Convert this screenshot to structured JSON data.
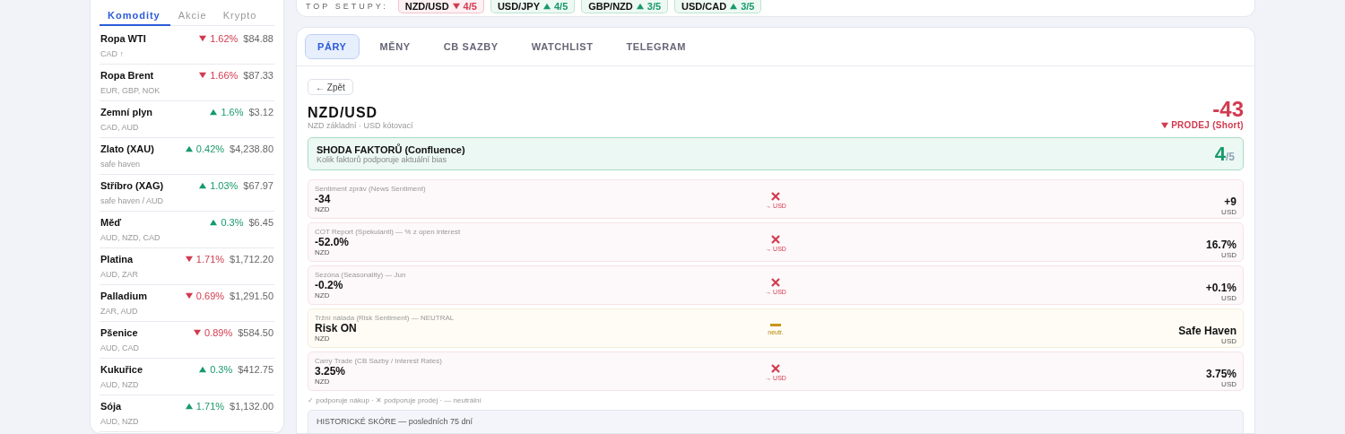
{
  "top_setups": {
    "label": "TOP SETUPY:",
    "items": [
      {
        "pair": "NZD/USD",
        "falling": true,
        "score": "4/5"
      },
      {
        "pair": "USD/JPY",
        "falling": false,
        "score": "4/5"
      },
      {
        "pair": "GBP/NZD",
        "falling": false,
        "score": "3/5"
      },
      {
        "pair": "USD/CAD",
        "falling": false,
        "score": "3/5"
      }
    ]
  },
  "sidebar": {
    "tabs": [
      {
        "label": "Komodity",
        "selected": true
      },
      {
        "label": "Akcie",
        "selected": false
      },
      {
        "label": "Krypto",
        "selected": false
      }
    ],
    "items": [
      {
        "name": "Ropa WTI",
        "falling": true,
        "change": "1.62%",
        "price": "$84.88",
        "note": "CAD ↑"
      },
      {
        "name": "Ropa Brent",
        "falling": true,
        "change": "1.66%",
        "price": "$87.33",
        "note": "EUR, GBP, NOK"
      },
      {
        "name": "Zemní plyn",
        "falling": false,
        "change": "1.6%",
        "price": "$3.12",
        "note": "CAD, AUD"
      },
      {
        "name": "Zlato (XAU)",
        "falling": false,
        "change": "0.42%",
        "price": "$4,238.80",
        "note": "safe haven"
      },
      {
        "name": "Stříbro (XAG)",
        "falling": false,
        "change": "1.03%",
        "price": "$67.97",
        "note": "safe haven / AUD"
      },
      {
        "name": "Měď",
        "falling": false,
        "change": "0.3%",
        "price": "$6.45",
        "note": "AUD, NZD, CAD"
      },
      {
        "name": "Platina",
        "falling": true,
        "change": "1.71%",
        "price": "$1,712.20",
        "note": "AUD, ZAR"
      },
      {
        "name": "Palladium",
        "falling": true,
        "change": "0.69%",
        "price": "$1,291.50",
        "note": "ZAR, AUD"
      },
      {
        "name": "Pšenice",
        "falling": true,
        "change": "0.89%",
        "price": "$584.50",
        "note": "AUD, CAD"
      },
      {
        "name": "Kukuřice",
        "falling": false,
        "change": "0.3%",
        "price": "$412.75",
        "note": "AUD, NZD"
      },
      {
        "name": "Sója",
        "falling": false,
        "change": "1.71%",
        "price": "$1,132.00",
        "note": "AUD, NZD"
      }
    ]
  },
  "tabs": [
    {
      "label": "PÁRY",
      "selected": true
    },
    {
      "label": "MĚNY",
      "selected": false
    },
    {
      "label": "CB SAZBY",
      "selected": false
    },
    {
      "label": "WATCHLIST",
      "selected": false
    },
    {
      "label": "TELEGRAM",
      "selected": false
    }
  ],
  "back_button": "← Zpět",
  "pair": {
    "title": "NZD/USD",
    "subtitle": "NZD základní · USD kótovací",
    "score": "-43",
    "falling": true,
    "signal": "PRODEJ (Short)"
  },
  "confluence": {
    "title": "SHODA FAKTORŮ (Confluence)",
    "subtitle": "Kolik faktorů podporuje aktuální bias",
    "count": "4",
    "total": "/5"
  },
  "factors": [
    {
      "kind": "sell",
      "label": "Sentiment zpráv (News Sentiment)",
      "base_value": "-34",
      "base": "NZD",
      "verdict": "→ USD",
      "quote_value": "+9",
      "quote": "USD"
    },
    {
      "kind": "sell",
      "label": "COT Report (Spekulanti) — % z open interest",
      "base_value": "-52.0%",
      "base": "NZD",
      "verdict": "→ USD",
      "quote_value": "16.7%",
      "quote": "USD"
    },
    {
      "kind": "sell",
      "label": "Sezóna (Seasonality) — Jun",
      "base_value": "-0.2%",
      "base": "NZD",
      "verdict": "→ USD",
      "quote_value": "+0.1%",
      "quote": "USD"
    },
    {
      "kind": "neutral",
      "label": "Tržní nálada (Risk Sentiment) — NEUTRAL",
      "base_value": "Risk ON",
      "base": "NZD",
      "verdict": "neutr.",
      "quote_value": "Safe Haven",
      "quote": "USD"
    },
    {
      "kind": "sell",
      "label": "Carry Trade (CB Sazby / Interest Rates)",
      "base_value": "3.25%",
      "base": "NZD",
      "verdict": "→ USD",
      "quote_value": "3.75%",
      "quote": "USD"
    }
  ],
  "legend": "✓ podporuje nákup · ✕ podporuje prodej · — neutrální",
  "history": {
    "title": "HISTORICKÉ SKÓRE — posledních 75 dní"
  }
}
